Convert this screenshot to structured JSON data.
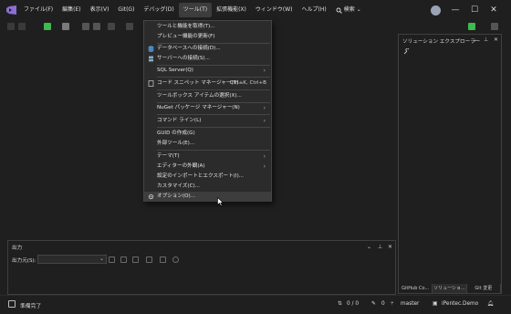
{
  "menu_bar": {
    "items": [
      "ファイル(F)",
      "編集(E)",
      "表示(V)",
      "Git(G)",
      "デバッグ(D)",
      "ツール(T)",
      "拡張機能(X)",
      "ウィンドウ(W)",
      "ヘルプ(H)"
    ],
    "search_label": "検索"
  },
  "window_controls": {
    "minimize": "—",
    "maximize": "☐",
    "close": "✕"
  },
  "tools_menu": {
    "items": [
      {
        "label": "ツールと機能を取得(T)...",
        "shortcut": "",
        "submenu": false
      },
      {
        "label": "プレビュー機能の更新(F)",
        "shortcut": "",
        "submenu": false
      },
      {
        "label": "データベースへの接続(D)...",
        "shortcut": "",
        "submenu": false
      },
      {
        "label": "サーバーへの接続(S)...",
        "shortcut": "",
        "submenu": false
      },
      {
        "label": "SQL Server(Q)",
        "shortcut": "",
        "submenu": true
      },
      {
        "label": "コード スニペット マネージャー(T)...",
        "shortcut": "Ctrl+K, Ctrl+B",
        "submenu": false
      },
      {
        "label": "ツールボックス アイテムの選択(X)...",
        "shortcut": "",
        "submenu": false
      },
      {
        "label": "NuGet パッケージ マネージャー(N)",
        "shortcut": "",
        "submenu": true
      },
      {
        "label": "コマンド ライン(L)",
        "shortcut": "",
        "submenu": true
      },
      {
        "label": "GUID の作成(G)",
        "shortcut": "",
        "submenu": false
      },
      {
        "label": "外部ツール(E)...",
        "shortcut": "",
        "submenu": false
      },
      {
        "label": "テーマ(T)",
        "shortcut": "",
        "submenu": true
      },
      {
        "label": "エディターの外観(A)",
        "shortcut": "",
        "submenu": true
      },
      {
        "label": "設定のインポートとエクスポート(I)...",
        "shortcut": "",
        "submenu": false
      },
      {
        "label": "カスタマイズ(C)...",
        "shortcut": "",
        "submenu": false
      },
      {
        "label": "オプション(O)...",
        "shortcut": "",
        "submenu": false
      }
    ]
  },
  "solution_explorer": {
    "title": "ソリューション エクスプローラー",
    "tabs": [
      "GitHub Co...",
      "ソリューショ...",
      "Git 変更"
    ]
  },
  "output_pane": {
    "title": "出力",
    "source_label": "出力元(S):",
    "source_value": ""
  },
  "status_bar": {
    "ready": "準備完了",
    "line_info": "0 / 0",
    "edit_count": "0",
    "branch": "master",
    "repo": "iPentec.Demo"
  },
  "colors": {
    "background": "#1f1f1f",
    "menu_bg": "#2b2b2b",
    "highlight": "#3d3d3d",
    "accent": "#6e40c9",
    "git_green": "#3fb950"
  }
}
